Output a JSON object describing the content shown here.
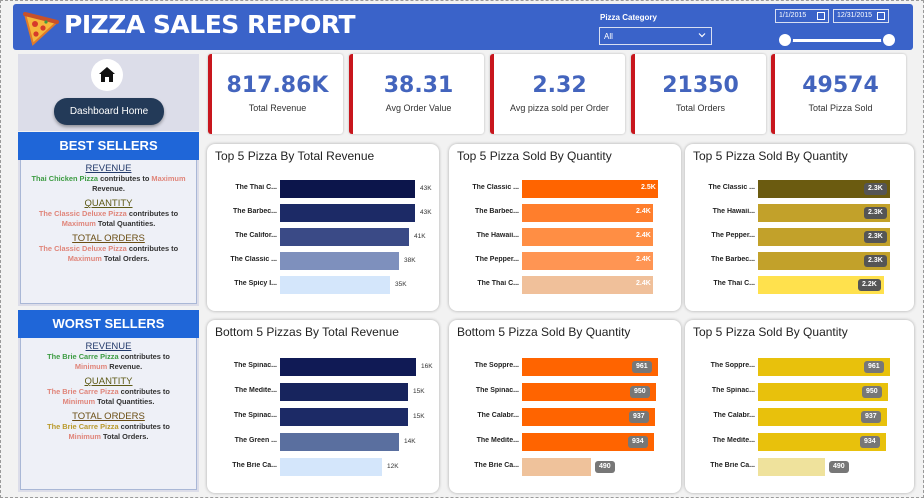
{
  "header": {
    "title": "PIZZA SALES REPORT",
    "category_label": "Pizza Category",
    "category_value": "All",
    "date_start": "1/1/2015",
    "date_end": "12/31/2015"
  },
  "nav": {
    "home_label": "Dashboard Home"
  },
  "best": {
    "title": "BEST SELLERS",
    "revenue": {
      "heading": "REVENUE",
      "pizza": "Thai Chicken Pizza",
      "pre": " contributes to ",
      "level": "Maximum",
      "post": " Revenue."
    },
    "quantity": {
      "heading": "QUANTITY",
      "pizza": "The Classic Deluxe Pizza",
      "pre": " contributes to",
      "level": "Maximum",
      "post": " Total Quantities."
    },
    "orders": {
      "heading": "TOTAL ORDERS",
      "pizza": "The Classic Deluxe Pizza",
      "pre": " contributes to",
      "level": "Maximum",
      "post": " Total Orders."
    }
  },
  "worst": {
    "title": "WORST SELLERS",
    "revenue": {
      "heading": "REVENUE",
      "pizza": "The Brie Carre Pizza",
      "pre": " contributes to",
      "level": "Minimum",
      "post": " Revenue."
    },
    "quantity": {
      "heading": "QUANTITY",
      "pizza": "The Brie Carre Pizza",
      "pre": " contributes to",
      "level": "Minimum",
      "post": " Total Quantities."
    },
    "orders": {
      "heading": "TOTAL ORDERS",
      "pizza": "The Brie Carre Pizza",
      "pre": " contributes to",
      "level": "Minimum",
      "post": " Total Orders."
    }
  },
  "kpis": [
    {
      "value": "817.86K",
      "label": "Total Revenue"
    },
    {
      "value": "38.31",
      "label": "Avg Order Value"
    },
    {
      "value": "2.32",
      "label": "Avg pizza sold per Order"
    },
    {
      "value": "21350",
      "label": "Total Orders"
    },
    {
      "value": "49574",
      "label": "Total Pizza Sold"
    }
  ],
  "colors": {
    "header_blue": "#3a63c9",
    "kpi_accent": "#c8161d",
    "kpi_value": "#4364bd",
    "sellers_head": "#1f66d8"
  },
  "chart_data": [
    {
      "type": "bar",
      "orientation": "horizontal",
      "title": "Top 5 Pizza By Total Revenue",
      "categories": [
        "The Thai C...",
        "The Barbec...",
        "The Califor...",
        "The Classic ...",
        "The Spicy I..."
      ],
      "values": [
        43,
        43,
        41,
        38,
        35
      ],
      "labels": [
        "43K",
        "43K",
        "41K",
        "38K",
        "35K"
      ],
      "xlim": [
        0,
        43
      ],
      "colors": [
        "#0c154b",
        "#1c2a66",
        "#3a4a86",
        "#7e90bd",
        "#d4e6fb"
      ]
    },
    {
      "type": "bar",
      "orientation": "horizontal",
      "title": "Top 5 Pizza Sold By Quantity",
      "categories": [
        "The Classic ...",
        "The Barbec...",
        "The Hawaii...",
        "The Pepper...",
        "The Thai C..."
      ],
      "values": [
        2.5,
        2.4,
        2.4,
        2.4,
        2.4
      ],
      "labels": [
        "2.5K",
        "2.4K",
        "2.4K",
        "2.4K",
        "2.4K"
      ],
      "xlim": [
        0,
        2.5
      ],
      "colors": [
        "#ff6400",
        "#ff7e2c",
        "#ff8e44",
        "#ff9553",
        "#f0c09a"
      ]
    },
    {
      "type": "bar",
      "orientation": "horizontal",
      "title": "Top 5 Pizza Sold By Quantity",
      "categories": [
        "The Classic ...",
        "The Hawaii...",
        "The Pepper...",
        "The Barbec...",
        "The Thai C..."
      ],
      "values": [
        2.3,
        2.3,
        2.3,
        2.3,
        2.2
      ],
      "labels": [
        "2.3K",
        "2.3K",
        "2.3K",
        "2.3K",
        "2.2K"
      ],
      "xlim": [
        0,
        2.3
      ],
      "colors": [
        "#6b5b10",
        "#c2a12a",
        "#c2a12a",
        "#c2a12a",
        "#ffe14d"
      ]
    },
    {
      "type": "bar",
      "orientation": "horizontal",
      "title": "Bottom 5 Pizzas By Total Revenue",
      "categories": [
        "The Spinac...",
        "The Medite...",
        "The Spinac...",
        "The Green ...",
        "The Brie Ca..."
      ],
      "values": [
        16,
        15,
        15,
        14,
        12
      ],
      "labels": [
        "16K",
        "15K",
        "15K",
        "14K",
        "12K"
      ],
      "xlim": [
        0,
        16
      ],
      "colors": [
        "#101a55",
        "#17245d",
        "#1c2a66",
        "#5a6f9f",
        "#d4e6fb"
      ]
    },
    {
      "type": "bar",
      "orientation": "horizontal",
      "title": "Bottom 5 Pizza Sold By Quantity",
      "categories": [
        "The Soppre...",
        "The Spinac...",
        "The Calabr...",
        "The Medite...",
        "The Brie Ca..."
      ],
      "values": [
        961,
        950,
        937,
        934,
        490
      ],
      "labels": [
        "961",
        "950",
        "937",
        "934",
        "490"
      ],
      "xlim": [
        0,
        961
      ],
      "colors": [
        "#ff6400",
        "#ff6400",
        "#ff6400",
        "#ff6400",
        "#efc29b"
      ]
    },
    {
      "type": "bar",
      "orientation": "horizontal",
      "title": "Top 5 Pizza Sold By Quantity",
      "categories": [
        "The Soppre...",
        "The Spinac...",
        "The Calabr...",
        "The Medite...",
        "The Brie Ca..."
      ],
      "values": [
        961,
        950,
        937,
        934,
        490
      ],
      "labels": [
        "961",
        "950",
        "937",
        "934",
        "490"
      ],
      "xlim": [
        0,
        961
      ],
      "colors": [
        "#e8c10c",
        "#e8c10c",
        "#e8c10c",
        "#e8c10c",
        "#efe29c"
      ]
    }
  ]
}
